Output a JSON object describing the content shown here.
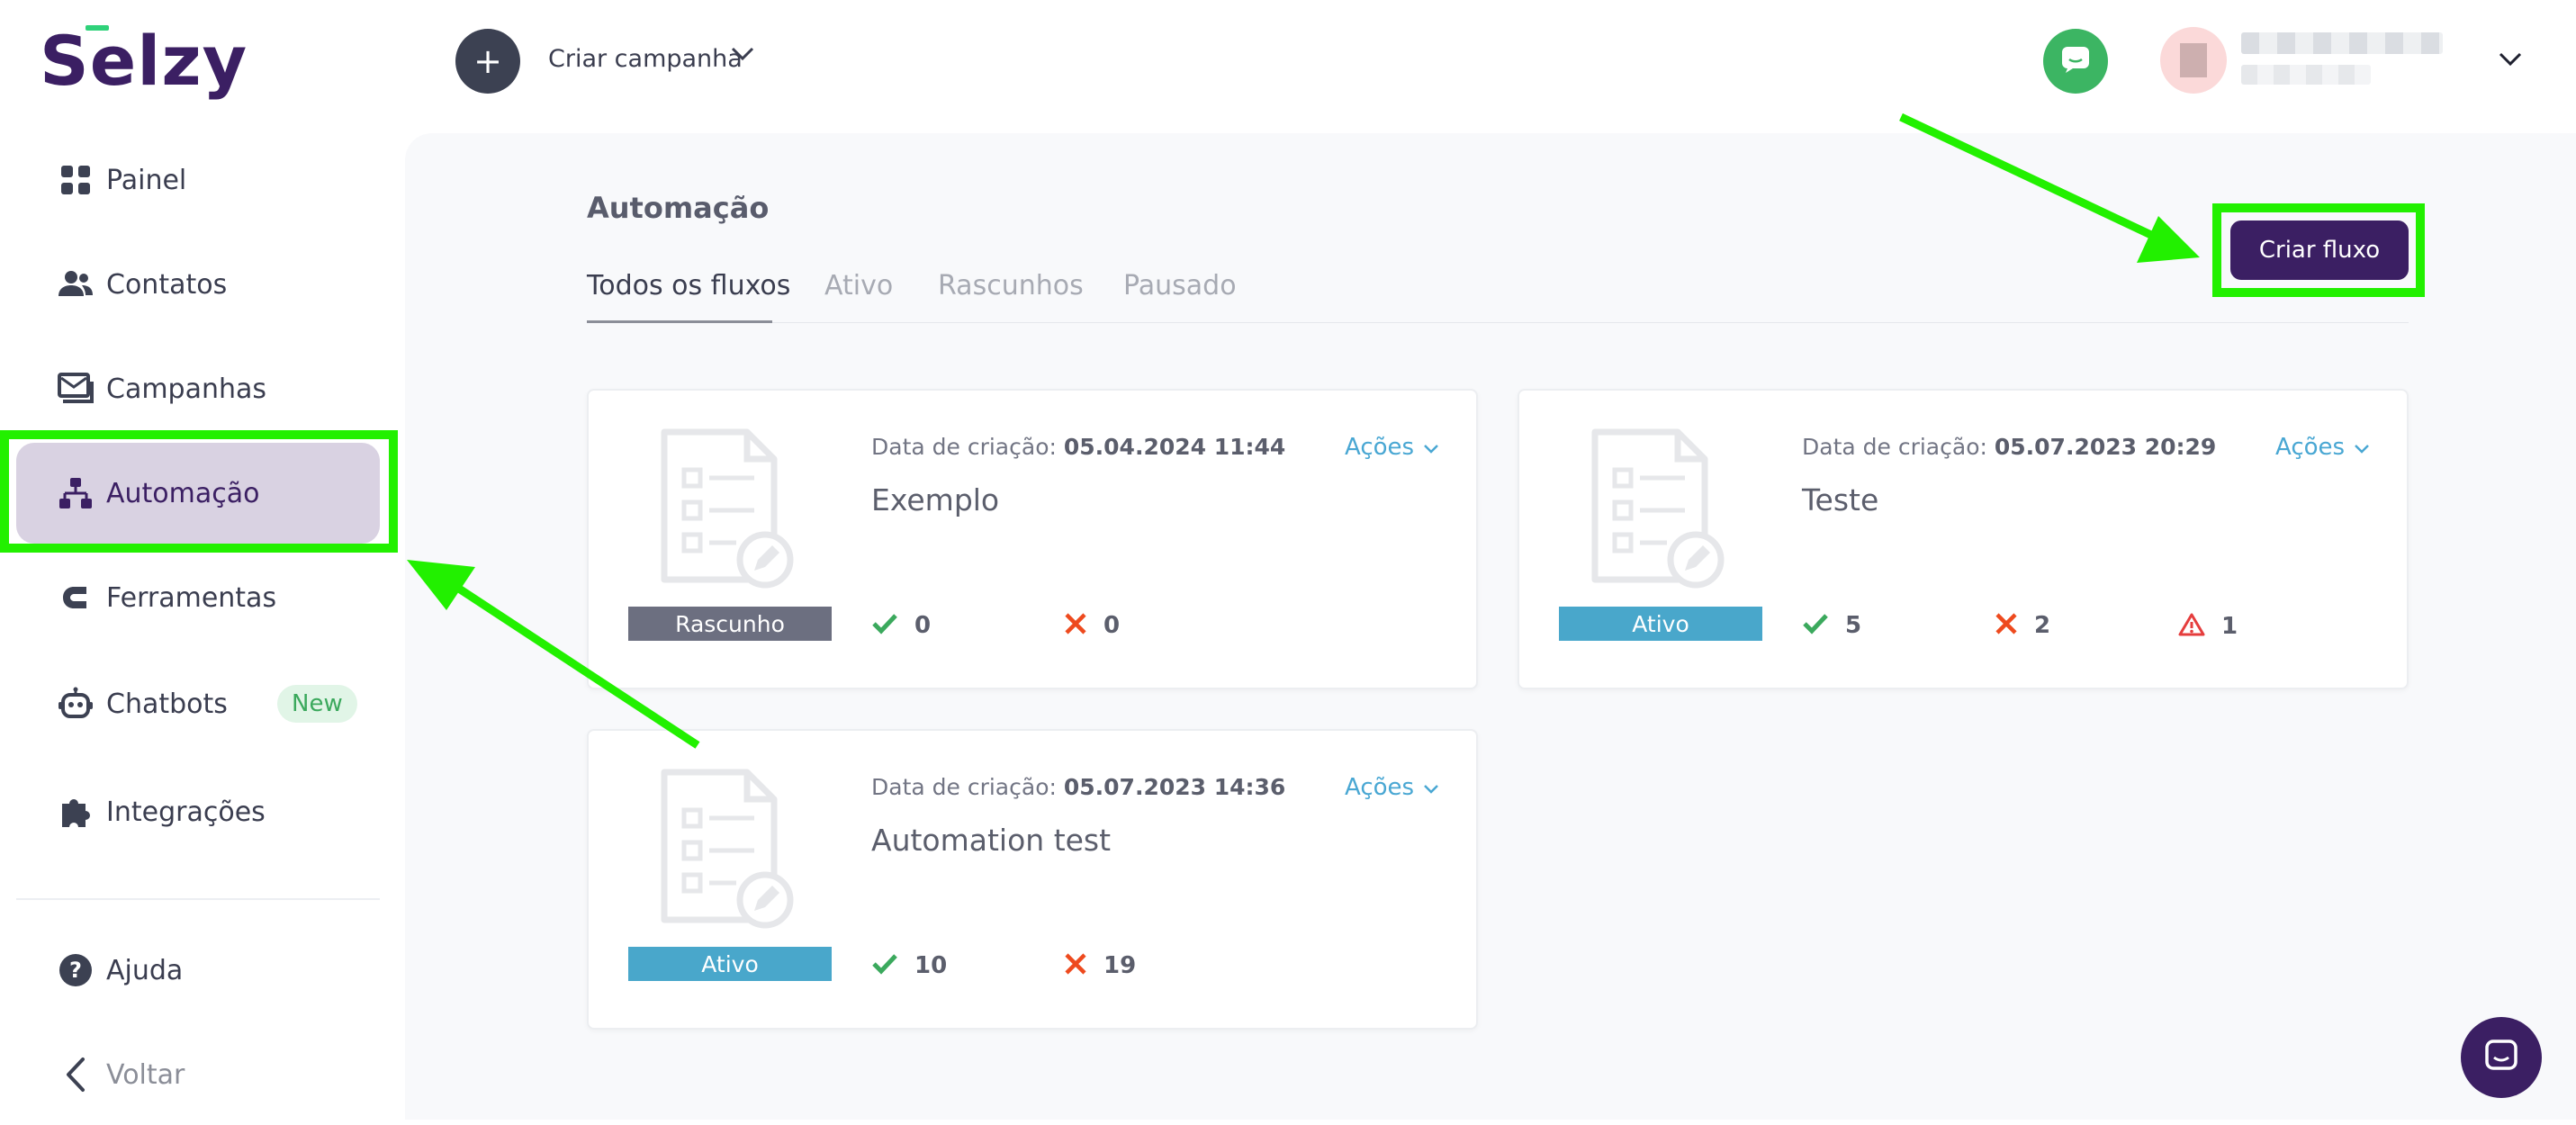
{
  "app": {
    "logo_text": "Selzy"
  },
  "colors": {
    "brand": "#3b1f63",
    "accent_link": "#49a7d3",
    "success": "#3ba95d",
    "error": "#ee4a1e",
    "warning": "#e53d3d",
    "highlight": "#22f000",
    "status_draft": "#6c6f80",
    "status_active": "#49a7cb"
  },
  "sidebar": {
    "items": [
      {
        "label": "Painel",
        "icon": "dashboard-grid-icon"
      },
      {
        "label": "Contatos",
        "icon": "users-icon"
      },
      {
        "label": "Campanhas",
        "icon": "campaigns-icon"
      },
      {
        "label": "Automação",
        "icon": "automation-tree-icon",
        "active": true
      },
      {
        "label": "Ferramentas",
        "icon": "tools-magnet-icon"
      },
      {
        "label": "Chatbots",
        "icon": "robot-icon",
        "badge": "New"
      },
      {
        "label": "Integrações",
        "icon": "puzzle-icon"
      }
    ],
    "bottom": [
      {
        "label": "Ajuda",
        "icon": "help-circle-icon"
      },
      {
        "label": "Voltar",
        "icon": "chevron-left-icon"
      }
    ]
  },
  "topbar": {
    "create_campaign": "Criar campanha",
    "create_icon": "plus-icon",
    "chat_icon": "chat-icon"
  },
  "main": {
    "title": "Automação",
    "tabs": [
      {
        "label": "Todos os fluxos",
        "active": true
      },
      {
        "label": "Ativo"
      },
      {
        "label": "Rascunhos"
      },
      {
        "label": "Pausado"
      }
    ],
    "create_flow_button": "Criar fluxo"
  },
  "flows": [
    {
      "created_label": "Data de criação:",
      "created_value": "05.04.2024 11:44",
      "actions": "Ações",
      "name": "Exemplo",
      "status": "Rascunho",
      "sent": "0",
      "failed": "0"
    },
    {
      "created_label": "Data de criação:",
      "created_value": "05.07.2023 20:29",
      "actions": "Ações",
      "name": "Teste",
      "status": "Ativo",
      "sent": "5",
      "failed": "2",
      "warnings": "1"
    },
    {
      "created_label": "Data de criação:",
      "created_value": "05.07.2023 14:36",
      "actions": "Ações",
      "name": "Automation test",
      "status": "Ativo",
      "sent": "10",
      "failed": "19"
    }
  ]
}
